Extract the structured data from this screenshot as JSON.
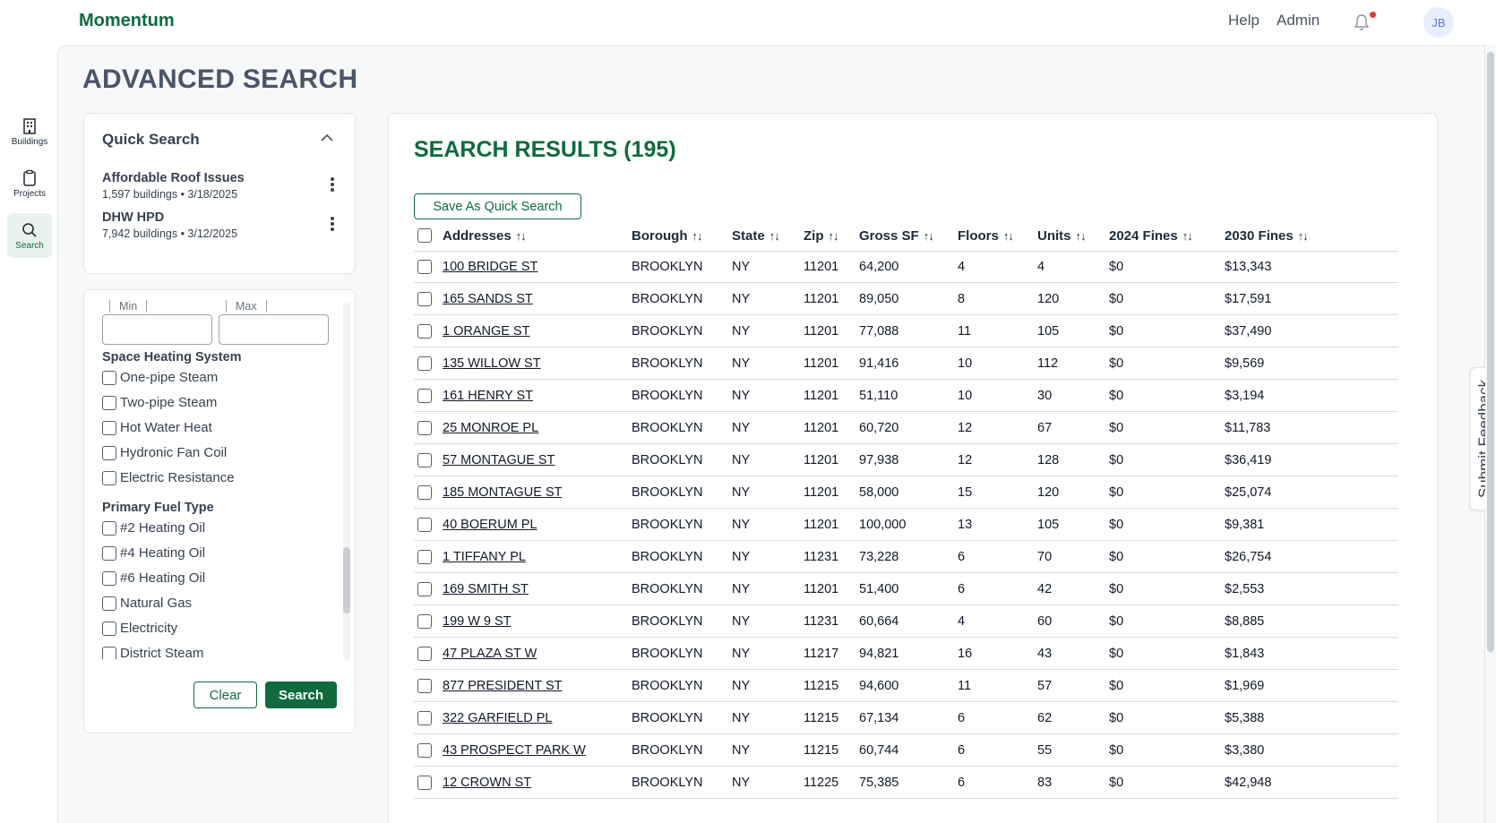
{
  "app": {
    "brand": "Momentum"
  },
  "topnav": {
    "help": "Help",
    "admin": "Admin",
    "avatar_initials": "JB",
    "notification_dot_color": "#e53935"
  },
  "rail": [
    {
      "label": "Buildings",
      "icon": "building-icon",
      "active": false
    },
    {
      "label": "Projects",
      "icon": "clipboard-icon",
      "active": false
    },
    {
      "label": "Search",
      "icon": "search-icon",
      "active": true
    }
  ],
  "page": {
    "title": "ADVANCED SEARCH"
  },
  "quick_search": {
    "title": "Quick Search",
    "items": [
      {
        "name": "Affordable Roof Issues",
        "meta": "1,597 buildings • 3/18/2025"
      },
      {
        "name": "DHW HPD",
        "meta": "7,942 buildings • 3/12/2025"
      }
    ]
  },
  "filters": {
    "range": {
      "min_label": "Min",
      "max_label": "Max",
      "min_value": "",
      "max_value": ""
    },
    "space_heating": {
      "title": "Space Heating System",
      "options": [
        "One-pipe Steam",
        "Two-pipe Steam",
        "Hot Water Heat",
        "Hydronic Fan Coil",
        "Electric Resistance"
      ]
    },
    "fuel_type": {
      "title": "Primary Fuel Type",
      "options": [
        "#2 Heating Oil",
        "#4 Heating Oil",
        "#6 Heating Oil",
        "Natural Gas",
        "Electricity",
        "District Steam"
      ]
    },
    "clear_label": "Clear",
    "search_label": "Search"
  },
  "results": {
    "title": "SEARCH RESULTS (195)",
    "save_label": "Save As Quick Search",
    "columns": [
      "Addresses",
      "Borough",
      "State",
      "Zip",
      "Gross SF",
      "Floors",
      "Units",
      "2024 Fines",
      "2030 Fines"
    ],
    "sort_glyph": "↑↓",
    "rows": [
      [
        "100 BRIDGE ST",
        "BROOKLYN",
        "NY",
        "11201",
        "64,200",
        "4",
        "4",
        "$0",
        "$13,343"
      ],
      [
        "165 SANDS ST",
        "BROOKLYN",
        "NY",
        "11201",
        "89,050",
        "8",
        "120",
        "$0",
        "$17,591"
      ],
      [
        "1 ORANGE ST",
        "BROOKLYN",
        "NY",
        "11201",
        "77,088",
        "11",
        "105",
        "$0",
        "$37,490"
      ],
      [
        "135 WILLOW ST",
        "BROOKLYN",
        "NY",
        "11201",
        "91,416",
        "10",
        "112",
        "$0",
        "$9,569"
      ],
      [
        "161 HENRY ST",
        "BROOKLYN",
        "NY",
        "11201",
        "51,110",
        "10",
        "30",
        "$0",
        "$3,194"
      ],
      [
        "25 MONROE PL",
        "BROOKLYN",
        "NY",
        "11201",
        "60,720",
        "12",
        "67",
        "$0",
        "$11,783"
      ],
      [
        "57 MONTAGUE ST",
        "BROOKLYN",
        "NY",
        "11201",
        "97,938",
        "12",
        "128",
        "$0",
        "$36,419"
      ],
      [
        "185 MONTAGUE ST",
        "BROOKLYN",
        "NY",
        "11201",
        "58,000",
        "15",
        "120",
        "$0",
        "$25,074"
      ],
      [
        "40 BOERUM PL",
        "BROOKLYN",
        "NY",
        "11201",
        "100,000",
        "13",
        "105",
        "$0",
        "$9,381"
      ],
      [
        "1 TIFFANY PL",
        "BROOKLYN",
        "NY",
        "11231",
        "73,228",
        "6",
        "70",
        "$0",
        "$26,754"
      ],
      [
        "169 SMITH ST",
        "BROOKLYN",
        "NY",
        "11201",
        "51,400",
        "6",
        "42",
        "$0",
        "$2,553"
      ],
      [
        "199 W 9 ST",
        "BROOKLYN",
        "NY",
        "11231",
        "60,664",
        "4",
        "60",
        "$0",
        "$8,885"
      ],
      [
        "47 PLAZA ST W",
        "BROOKLYN",
        "NY",
        "11217",
        "94,821",
        "16",
        "43",
        "$0",
        "$1,843"
      ],
      [
        "877 PRESIDENT ST",
        "BROOKLYN",
        "NY",
        "11215",
        "94,600",
        "11",
        "57",
        "$0",
        "$1,969"
      ],
      [
        "322 GARFIELD PL",
        "BROOKLYN",
        "NY",
        "11215",
        "67,134",
        "6",
        "62",
        "$0",
        "$5,388"
      ],
      [
        "43 PROSPECT PARK W",
        "BROOKLYN",
        "NY",
        "11215",
        "60,744",
        "6",
        "55",
        "$0",
        "$3,380"
      ],
      [
        "12 CROWN ST",
        "BROOKLYN",
        "NY",
        "11225",
        "75,385",
        "6",
        "83",
        "$0",
        "$42,948"
      ]
    ]
  },
  "feedback": {
    "label": "Submit Feedback"
  },
  "colors": {
    "brand_green": "#0f6b3e",
    "title_gray": "#4a5568"
  }
}
